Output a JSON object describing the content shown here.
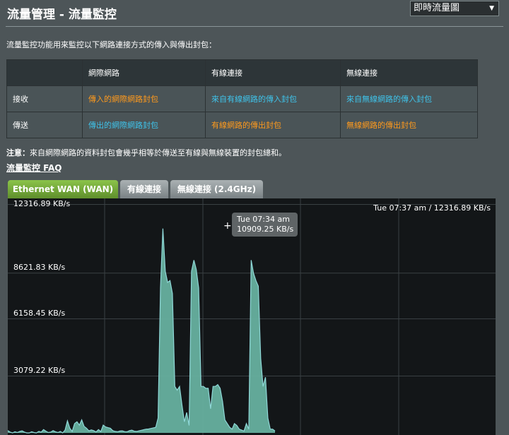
{
  "page": {
    "title": "流量管理 - 流量監控",
    "view_select": "即時流量圖",
    "description": "流量監控功能用來監控以下網路連接方式的傳入與傳出封包：",
    "note_label": "注意：",
    "note_text": "來自網際網路的資料封包會幾乎相等於傳送至有線與無線裝置的封包總和。",
    "faq_link": "流量監控 FAQ"
  },
  "table": {
    "headers": [
      "",
      "網際網路",
      "有線連接",
      "無線連接"
    ],
    "rows": [
      {
        "label": "接收",
        "cells": [
          "傳入的網際網路封包",
          "來自有線網路的傳入封包",
          "來自無線網路的傳入封包"
        ]
      },
      {
        "label": "傳送",
        "cells": [
          "傳出的網際網路封包",
          "有線網路的傳出封包",
          "無線網路的傳出封包"
        ]
      }
    ]
  },
  "tabs": [
    "Ethernet WAN (WAN)",
    "有線連接",
    "無線連接 (2.4GHz)"
  ],
  "colors": {
    "accent_green": "#8bc34a",
    "orange_link": "#ff9a1d",
    "blue_link": "#3fc3ea",
    "area_fill": "#66b09f",
    "area_line": "#8fd8d8"
  },
  "chart_data": {
    "type": "area",
    "yticks": [
      "12316.89 KB/s",
      "8621.83 KB/s",
      "6158.45 KB/s",
      "3079.22 KB/s"
    ],
    "ytick_values": [
      12316.89,
      8621.83,
      6158.45,
      3079.22
    ],
    "ylim": [
      0,
      12316.89
    ],
    "current_label": "Tue 07:37 am / 12316.89 KB/s",
    "tooltip": {
      "time": "Tue 07:34 am",
      "value": "10909.25 KB/s"
    },
    "grid": true,
    "values": [
      120,
      40,
      0,
      60,
      20,
      80,
      110,
      40,
      0,
      0,
      60,
      20,
      0,
      80,
      40,
      180,
      90,
      20,
      40,
      120,
      60,
      20,
      80,
      0,
      150,
      650,
      250,
      80,
      500,
      600,
      420,
      700,
      350,
      250,
      110,
      160,
      120,
      50,
      180,
      70,
      420,
      320,
      280,
      250,
      120,
      80,
      60,
      100,
      110,
      70,
      60,
      120,
      150,
      90,
      80,
      110,
      140,
      170,
      200,
      210,
      240,
      270,
      300,
      800,
      7800,
      11000,
      8700,
      8100,
      8200,
      7500,
      2500,
      2300,
      2500,
      1500,
      600,
      1100,
      400,
      8700,
      9300,
      8800,
      7800,
      2500,
      2500,
      2400,
      2400,
      1300,
      2500,
      2500,
      2600,
      2400,
      1700,
      700,
      500,
      300,
      200,
      500,
      400,
      200,
      150,
      100,
      500,
      200,
      9300,
      8600,
      8200,
      7900,
      4000,
      2500,
      3000,
      800,
      200,
      200,
      100
    ]
  }
}
